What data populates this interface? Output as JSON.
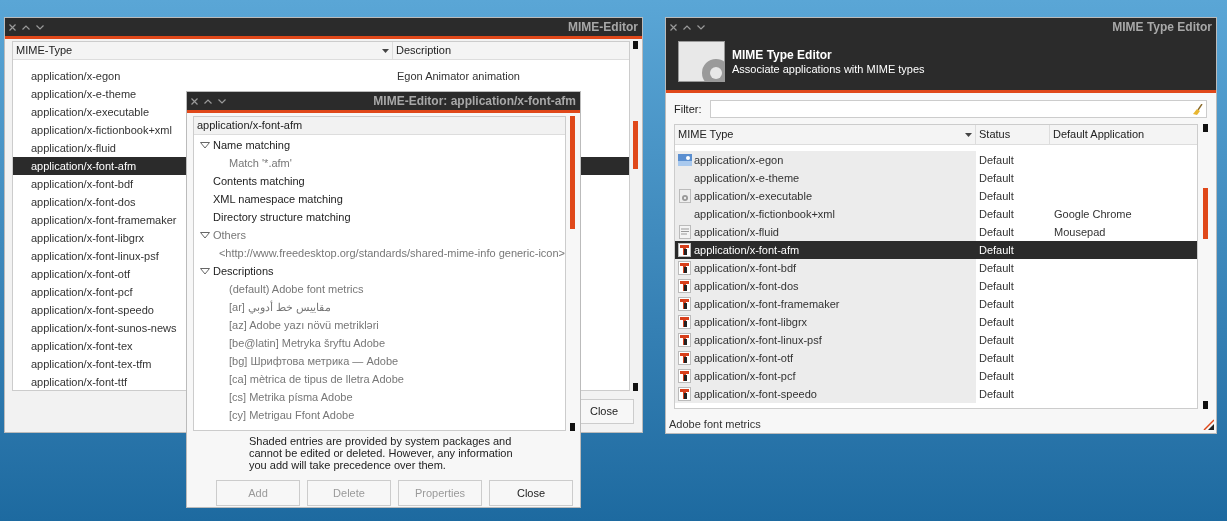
{
  "mime_editor": {
    "title": "MIME-Editor",
    "columns": [
      "MIME-Type",
      "Description"
    ],
    "rows": [
      {
        "mime": "application/x-egon",
        "description": "Egon Animator animation",
        "selected": false
      },
      {
        "mime": "application/x-e-theme",
        "selected": false
      },
      {
        "mime": "application/x-executable",
        "selected": false
      },
      {
        "mime": "application/x-fictionbook+xml",
        "selected": false
      },
      {
        "mime": "application/x-fluid",
        "selected": false
      },
      {
        "mime": "application/x-font-afm",
        "selected": true
      },
      {
        "mime": "application/x-font-bdf",
        "selected": false
      },
      {
        "mime": "application/x-font-dos",
        "selected": false
      },
      {
        "mime": "application/x-font-framemaker",
        "selected": false
      },
      {
        "mime": "application/x-font-libgrx",
        "selected": false
      },
      {
        "mime": "application/x-font-linux-psf",
        "selected": false
      },
      {
        "mime": "application/x-font-otf",
        "selected": false
      },
      {
        "mime": "application/x-font-pcf",
        "selected": false
      },
      {
        "mime": "application/x-font-speedo",
        "selected": false
      },
      {
        "mime": "application/x-font-sunos-news",
        "selected": false
      },
      {
        "mime": "application/x-font-tex",
        "selected": false
      },
      {
        "mime": "application/x-font-tex-tfm",
        "selected": false
      },
      {
        "mime": "application/x-font-ttf",
        "selected": false
      }
    ],
    "close_button": "Close"
  },
  "dialog": {
    "title": "MIME-Editor: application/x-font-afm",
    "type_field": "application/x-font-afm",
    "tree": [
      {
        "label": "Name matching",
        "shaded": false,
        "expanded": true,
        "children": [
          {
            "label": "Match '*.afm'",
            "shaded": true
          }
        ]
      },
      {
        "label": "Contents matching",
        "shaded": false
      },
      {
        "label": "XML namespace matching",
        "shaded": false
      },
      {
        "label": "Directory structure matching",
        "shaded": false
      },
      {
        "label": "Others",
        "shaded": true,
        "expanded": true,
        "children": [
          {
            "label": "<http://www.freedesktop.org/standards/shared-mime-info generic-icon>",
            "shaded": true
          }
        ]
      },
      {
        "label": "Descriptions",
        "shaded": false,
        "expanded": true,
        "children": [
          {
            "label": "(default) Adobe font metrics",
            "shaded": true
          },
          {
            "label": "[ar] مقاييس خط أدوبي",
            "shaded": true
          },
          {
            "label": "[az] Adobe yazı növü metrikləri",
            "shaded": true
          },
          {
            "label": "[be@latin] Metryka šryftu Adobe",
            "shaded": true
          },
          {
            "label": "[bg] Шрифтова метрика — Adobe",
            "shaded": true
          },
          {
            "label": "[ca] mètrica de tipus de lletra Adobe",
            "shaded": true
          },
          {
            "label": "[cs] Metrika písma Adobe",
            "shaded": true
          },
          {
            "label": "[cy] Metrigau Ffont Adobe",
            "shaded": true
          }
        ]
      }
    ],
    "note": "Shaded entries are provided by system packages and cannot be edited or deleted. However, any information you add will take precedence over them.",
    "buttons": [
      {
        "label": "Add",
        "disabled": true
      },
      {
        "label": "Delete",
        "disabled": true
      },
      {
        "label": "Properties",
        "disabled": true
      },
      {
        "label": "Close",
        "disabled": false
      }
    ]
  },
  "type_editor": {
    "title": "MIME Type Editor",
    "header_title": "MIME Type Editor",
    "header_subtitle": "Associate applications with MIME types",
    "filter_label": "Filter:",
    "columns": [
      "MIME Type",
      "Status",
      "Default Application"
    ],
    "rows": [
      {
        "mime": "application/x-egon",
        "status": "Default",
        "kind": "image",
        "selected": false
      },
      {
        "mime": "application/x-e-theme",
        "status": "Default",
        "selected": false
      },
      {
        "mime": "application/x-executable",
        "status": "Default",
        "kind": "executable",
        "selected": false
      },
      {
        "mime": "application/x-fictionbook+xml",
        "status": "Default",
        "application": "Google Chrome",
        "selected": false
      },
      {
        "mime": "application/x-fluid",
        "status": "Default",
        "application": "Mousepad",
        "kind": "document",
        "selected": false
      },
      {
        "mime": "application/x-font-afm",
        "status": "Default",
        "kind": "font",
        "selected": true
      },
      {
        "mime": "application/x-font-bdf",
        "status": "Default",
        "kind": "font",
        "selected": false
      },
      {
        "mime": "application/x-font-dos",
        "status": "Default",
        "kind": "font",
        "selected": false
      },
      {
        "mime": "application/x-font-framemaker",
        "status": "Default",
        "kind": "font",
        "selected": false
      },
      {
        "mime": "application/x-font-libgrx",
        "status": "Default",
        "kind": "font",
        "selected": false
      },
      {
        "mime": "application/x-font-linux-psf",
        "status": "Default",
        "kind": "font",
        "selected": false
      },
      {
        "mime": "application/x-font-otf",
        "status": "Default",
        "kind": "font",
        "selected": false
      },
      {
        "mime": "application/x-font-pcf",
        "status": "Default",
        "kind": "font",
        "selected": false
      },
      {
        "mime": "application/x-font-speedo",
        "status": "Default",
        "kind": "font",
        "selected": false
      }
    ],
    "status_bar": "Adobe font metrics"
  }
}
